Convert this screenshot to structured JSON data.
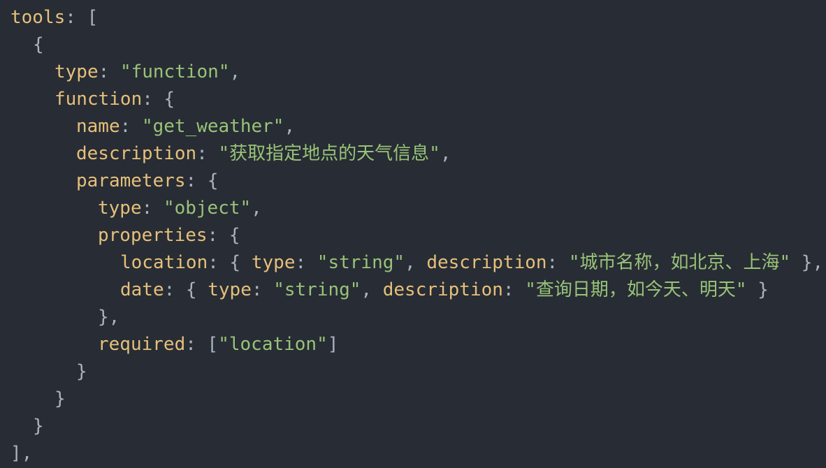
{
  "theme": {
    "background": "#282c34",
    "key_color": "#e5c07b",
    "string_color": "#98c379",
    "punctuation_color": "#abb2bf"
  },
  "code": {
    "l1": {
      "k1": "tools",
      "p1": ": ["
    },
    "l2": {
      "p1": "{"
    },
    "l3": {
      "k1": "type",
      "p1": ": ",
      "s1": "\"function\"",
      "p2": ","
    },
    "l4": {
      "k1": "function",
      "p1": ": {"
    },
    "l5": {
      "k1": "name",
      "p1": ": ",
      "s1": "\"get_weather\"",
      "p2": ","
    },
    "l6": {
      "k1": "description",
      "p1": ": ",
      "s1": "\"获取指定地点的天气信息\"",
      "p2": ","
    },
    "l7": {
      "k1": "parameters",
      "p1": ": {"
    },
    "l8": {
      "k1": "type",
      "p1": ": ",
      "s1": "\"object\"",
      "p2": ","
    },
    "l9": {
      "k1": "properties",
      "p1": ": {"
    },
    "l10": {
      "k1": "location",
      "p1": ": { ",
      "k2": "type",
      "p2": ": ",
      "s1": "\"string\"",
      "p3": ", ",
      "k3": "description",
      "p4": ": ",
      "s2": "\"城市名称，如北京、上海\"",
      "p5": " },"
    },
    "l11": {
      "k1": "date",
      "p1": ": { ",
      "k2": "type",
      "p2": ": ",
      "s1": "\"string\"",
      "p3": ", ",
      "k3": "description",
      "p4": ": ",
      "s2": "\"查询日期，如今天、明天\"",
      "p5": " }"
    },
    "l12": {
      "p1": "},"
    },
    "l13": {
      "k1": "required",
      "p1": ": [",
      "s1": "\"location\"",
      "p2": "]"
    },
    "l14": {
      "p1": "}"
    },
    "l15": {
      "p1": "}"
    },
    "l16": {
      "p1": "}"
    },
    "l17": {
      "p1": "],"
    }
  }
}
